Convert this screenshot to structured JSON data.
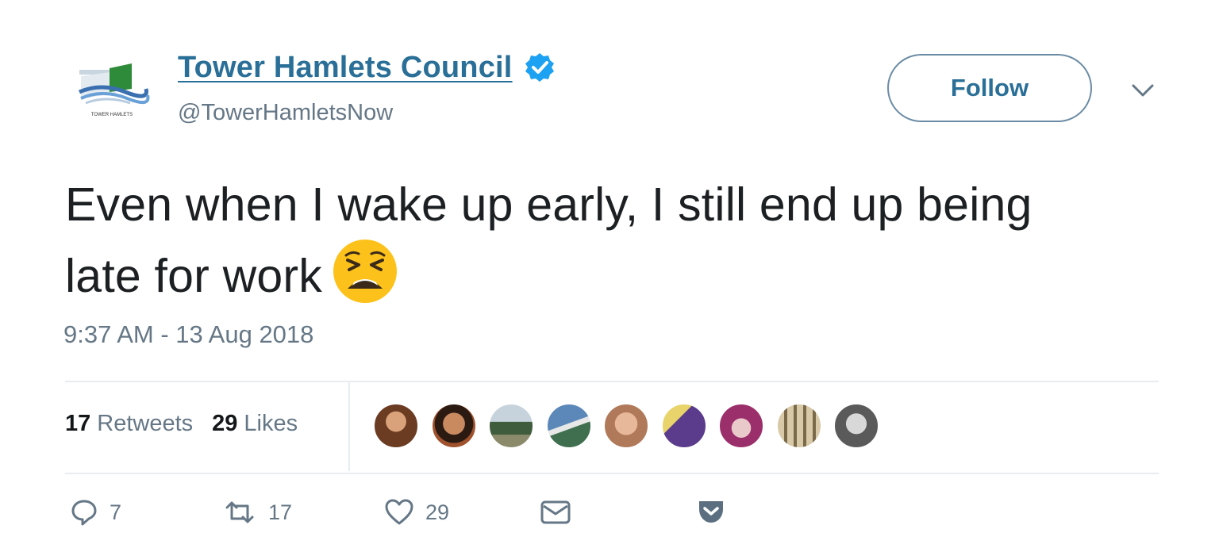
{
  "tweet": {
    "author": {
      "display_name": "Tower Hamlets Council",
      "handle": "@TowerHamletsNow",
      "verified": true,
      "avatar_icon": "tower-hamlets-logo",
      "logo_text": "TOWER HAMLETS"
    },
    "follow_label": "Follow",
    "text": "Even when I wake up early, I still end up being late for work",
    "emoji": "weary-face",
    "timestamp": "9:37 AM - 13 Aug 2018",
    "stats": {
      "retweets_count": "17",
      "retweets_label": "Retweets",
      "likes_count": "29",
      "likes_label": "Likes"
    },
    "liker_avatars_count": 9,
    "actions": {
      "reply_count": "7",
      "retweet_count": "17",
      "like_count": "29"
    }
  },
  "colors": {
    "link_blue": "#2a6f97",
    "verified_blue": "#1da1f2",
    "secondary_text": "#657786",
    "divider": "#e6ecf0"
  }
}
